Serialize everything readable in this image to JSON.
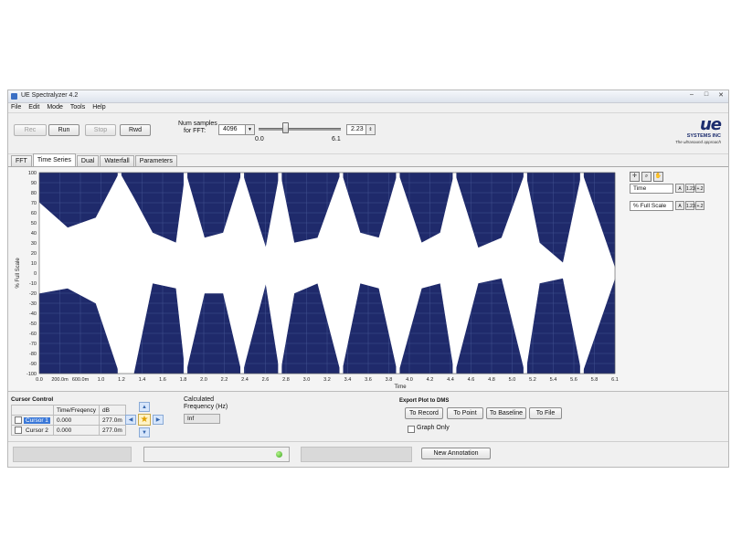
{
  "window": {
    "title": "UE Spectralyzer 4.2",
    "controls": [
      "–",
      "□",
      "✕"
    ]
  },
  "menu": [
    "File",
    "Edit",
    "Mode",
    "Tools",
    "Help"
  ],
  "toolbar": {
    "rec": "Rec",
    "run": "Run",
    "stop": "Stop",
    "rwd": "Rwd",
    "num_samples_label_1": "Num samples",
    "num_samples_label_2": "for FFT:",
    "num_samples_value": "4096",
    "slider_min": "0.0",
    "slider_max": "6.1",
    "slider_level": 0.32,
    "slider_value": "2.23"
  },
  "logo": {
    "text": "ue",
    "systems": "SYSTEMS INC",
    "tagline": "The ultrasound approach"
  },
  "tabs": [
    "FFT",
    "Time Series",
    "Dual",
    "Waterfall",
    "Parameters"
  ],
  "active_tab": "Time Series",
  "chart_data": {
    "type": "area",
    "title": "",
    "xlabel": "Time",
    "ylabel": "% Full Scale",
    "xlim": [
      0,
      6.1
    ],
    "ylim": [
      -100,
      100
    ],
    "x_ticks": [
      "0.0",
      "200.0m",
      "600.0m",
      "1.0",
      "1.2",
      "1.4",
      "1.6",
      "1.8",
      "2.0",
      "2.2",
      "2.4",
      "2.6",
      "2.8",
      "3.0",
      "3.2",
      "3.4",
      "3.6",
      "3.8",
      "4.0",
      "4.2",
      "4.4",
      "4.6",
      "4.8",
      "5.0",
      "5.2",
      "5.4",
      "5.6",
      "5.8",
      "6.1"
    ],
    "y_ticks": [
      100,
      90,
      80,
      70,
      60,
      50,
      40,
      30,
      20,
      10,
      0,
      -10,
      -20,
      -30,
      -40,
      -50,
      -60,
      -70,
      -80,
      -90,
      -100
    ],
    "grid": true,
    "series": [
      {
        "color": "#1f2a6b",
        "envelope": {
          "x": [
            0.0,
            0.3,
            0.6,
            0.85,
            1.0,
            1.2,
            1.45,
            1.55,
            1.75,
            1.95,
            2.15,
            2.4,
            2.55,
            2.7,
            2.95,
            3.2,
            3.4,
            3.6,
            3.8,
            4.05,
            4.25,
            4.4,
            4.65,
            4.9,
            5.15,
            5.3,
            5.55,
            5.75,
            6.1
          ],
          "top": [
            70,
            45,
            55,
            100,
            75,
            40,
            30,
            100,
            35,
            40,
            100,
            25,
            100,
            30,
            35,
            100,
            40,
            35,
            100,
            30,
            40,
            100,
            25,
            35,
            100,
            30,
            10,
            100,
            5
          ],
          "bottom": [
            -20,
            -15,
            -30,
            -100,
            -100,
            -10,
            -15,
            -100,
            -20,
            -20,
            -100,
            -10,
            -100,
            -20,
            -10,
            -100,
            -10,
            -15,
            -100,
            -15,
            -10,
            -100,
            -10,
            -5,
            -100,
            -10,
            -5,
            -100,
            -5
          ]
        }
      }
    ]
  },
  "side_panel": {
    "x_axis": "Time",
    "y_axis": "% Full Scale",
    "x_btns": [
      "A",
      "1.23",
      "+.2"
    ],
    "y_btns": [
      "A",
      "1.23",
      "+.2"
    ]
  },
  "cursor_control": {
    "title": "Cursor Control",
    "headers": [
      "",
      "Time/Freqency",
      "dB"
    ],
    "rows": [
      {
        "name": "Cursor 1",
        "time": "0.000",
        "db": "277.0m"
      },
      {
        "name": "Cursor 2",
        "time": "0.000",
        "db": "277.0m"
      }
    ]
  },
  "calc_freq": {
    "label_1": "Calculated",
    "label_2": "Frequency (Hz)",
    "value": "Inf"
  },
  "export": {
    "title": "Export Plot to DMS",
    "buttons": [
      "To Record",
      "To Point",
      "To Baseline",
      "To File"
    ],
    "graph_only": "Graph Only"
  },
  "status": {
    "new_annotation": "New Annotation"
  }
}
